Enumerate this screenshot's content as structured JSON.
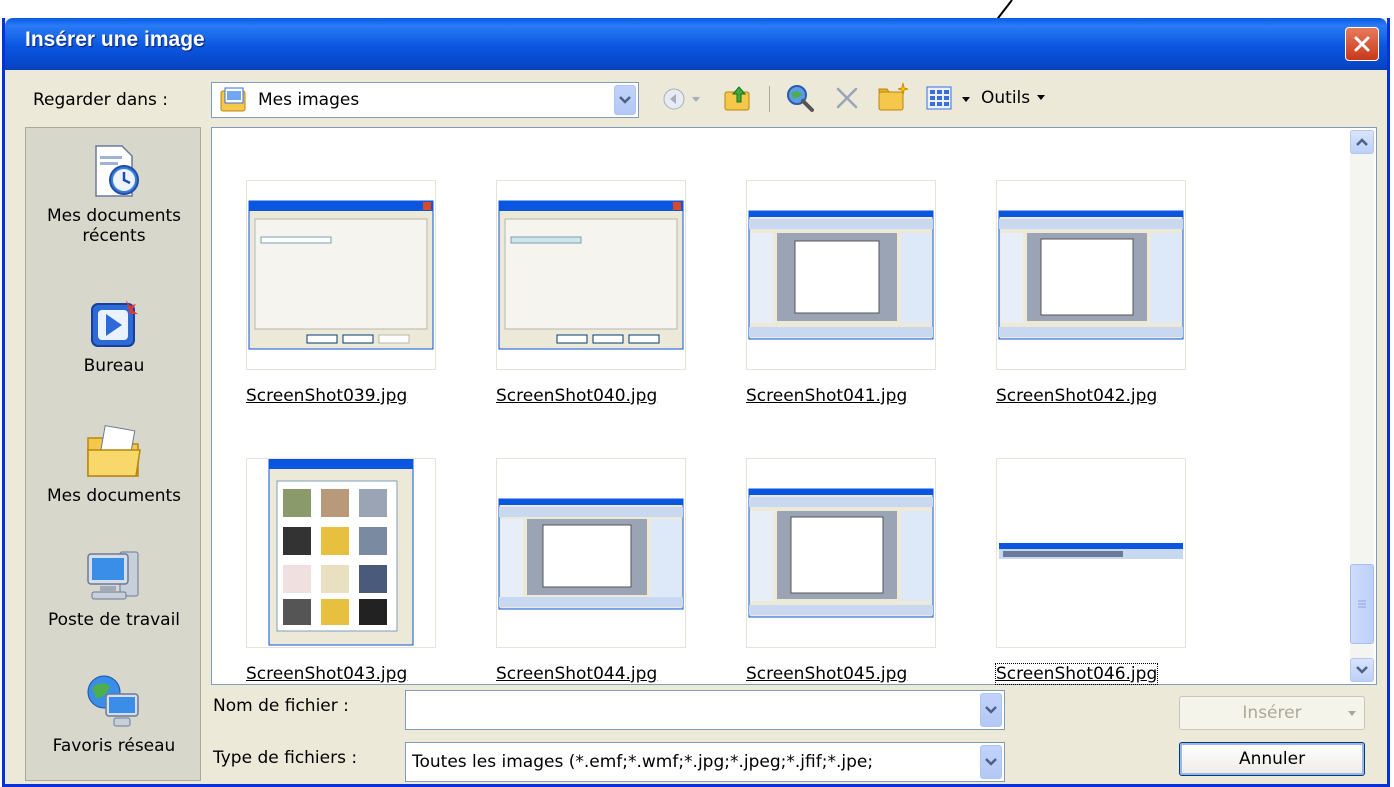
{
  "window": {
    "title": "Insérer une image"
  },
  "toolbar": {
    "look_in_label": "Regarder dans :",
    "look_in_value": "Mes images",
    "tools_label": "Outils"
  },
  "places": [
    {
      "label": "Mes documents récents",
      "icon": "recent-documents-icon"
    },
    {
      "label": "Bureau",
      "icon": "desktop-icon"
    },
    {
      "label": "Mes documents",
      "icon": "my-documents-icon"
    },
    {
      "label": "Poste de travail",
      "icon": "my-computer-icon"
    },
    {
      "label": "Favoris réseau",
      "icon": "network-places-icon"
    }
  ],
  "files": [
    {
      "name": "ScreenShot039.jpg"
    },
    {
      "name": "ScreenShot040.jpg"
    },
    {
      "name": "ScreenShot041.jpg"
    },
    {
      "name": "ScreenShot042.jpg"
    },
    {
      "name": "ScreenShot043.jpg"
    },
    {
      "name": "ScreenShot044.jpg"
    },
    {
      "name": "ScreenShot045.jpg"
    },
    {
      "name": "ScreenShot046.jpg",
      "selected": true
    }
  ],
  "form": {
    "filename_label": "Nom de fichier :",
    "filename_value": "",
    "filetype_label": "Type de fichiers :",
    "filetype_value": "Toutes les images (*.emf;*.wmf;*.jpg;*.jpeg;*.jfif;*.jpe;"
  },
  "buttons": {
    "insert": "Insérer",
    "cancel": "Annuler"
  },
  "colors": {
    "title_bar": "#0a56e0",
    "dialog_bg": "#ece9d8",
    "close_button": "#c8381a"
  }
}
